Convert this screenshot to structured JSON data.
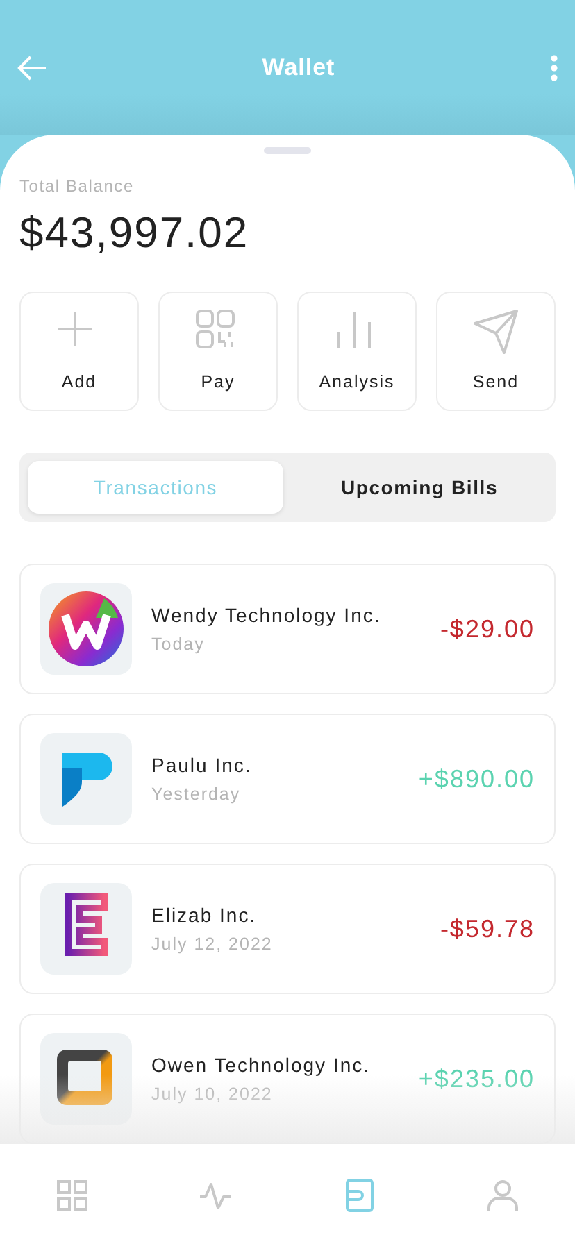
{
  "header": {
    "title": "Wallet"
  },
  "balance": {
    "label": "Total Balance",
    "amount": "$43,997.02"
  },
  "actions": [
    "Add",
    "Pay",
    "Analysis",
    "Send"
  ],
  "tabs": [
    {
      "label": "Transactions",
      "selected": true
    },
    {
      "label": "Upcoming Bills",
      "selected": false
    }
  ],
  "transactions": [
    {
      "name": "Wendy Technology Inc.",
      "date": "Today",
      "amount": "-$29.00",
      "kind": "debit"
    },
    {
      "name": "Paulu Inc.",
      "date": "Yesterday",
      "amount": "+$890.00",
      "kind": "credit"
    },
    {
      "name": "Elizab Inc.",
      "date": "July 12, 2022",
      "amount": "-$59.78",
      "kind": "debit"
    },
    {
      "name": "Owen Technology Inc.",
      "date": "July 10, 2022",
      "amount": "+$235.00",
      "kind": "credit"
    }
  ],
  "bottom_nav": [
    {
      "selected": false
    },
    {
      "selected": false
    },
    {
      "selected": true
    },
    {
      "selected": false
    }
  ]
}
